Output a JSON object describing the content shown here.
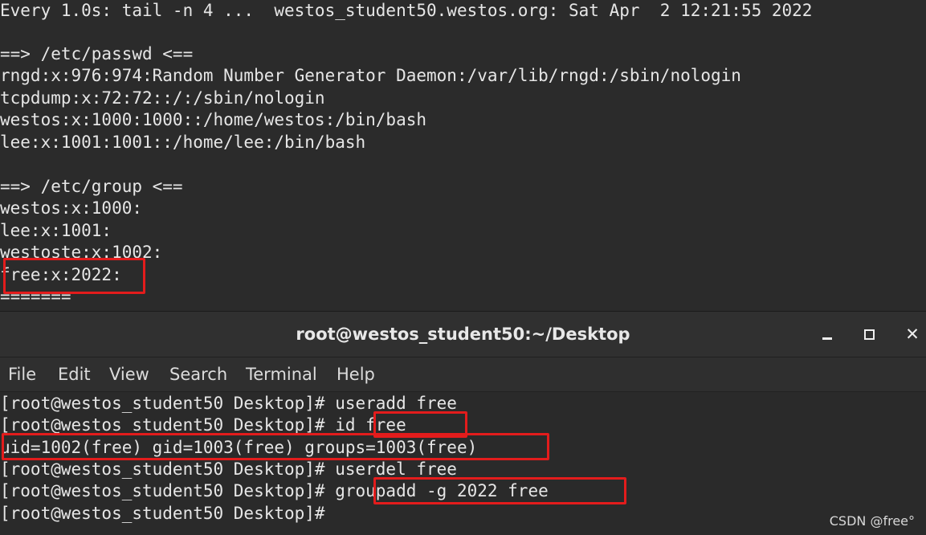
{
  "watch_terminal": {
    "header": "Every 1.0s: tail -n 4 ...  westos_student50.westos.org: Sat Apr  2 12:21:55 2022",
    "lines": [
      "",
      "==> /etc/passwd <==",
      "rngd:x:976:974:Random Number Generator Daemon:/var/lib/rngd:/sbin/nologin",
      "tcpdump:x:72:72::/:/sbin/nologin",
      "westos:x:1000:1000::/home/westos:/bin/bash",
      "lee:x:1001:1001::/home/lee:/bin/bash",
      "",
      "==> /etc/group <==",
      "westos:x:1000:",
      "lee:x:1001:",
      "westoste:x:1002:",
      "free:x:2022:",
      "======="
    ]
  },
  "window": {
    "title": "root@westos_student50:~/Desktop",
    "minimize": "_",
    "maximize": "□",
    "close": "✕"
  },
  "menu": [
    "File",
    "Edit",
    "View",
    "Search",
    "Terminal",
    "Help"
  ],
  "terminal": {
    "lines": [
      "[root@westos_student50 Desktop]# useradd free",
      "[root@westos_student50 Desktop]# id free",
      "uid=1002(free) gid=1003(free) groups=1003(free)",
      "[root@westos_student50 Desktop]# userdel free",
      "[root@westos_student50 Desktop]# groupadd -g 2022 free",
      "[root@westos_student50 Desktop]#"
    ]
  },
  "watermark": "CSDN @free°",
  "colors": {
    "background": "#2b2b2b",
    "text": "#e6e6e6",
    "highlight_box": "#e31c1c"
  }
}
